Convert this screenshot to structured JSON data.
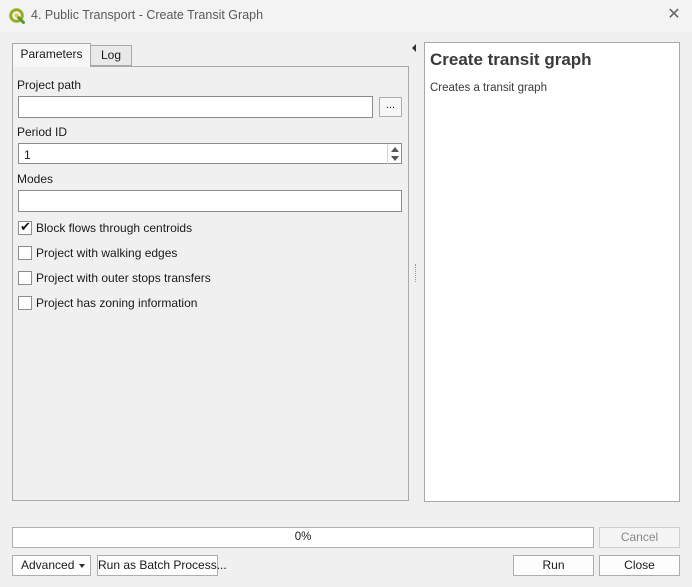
{
  "window": {
    "title": "4. Public Transport - Create Transit Graph",
    "logo_icon": "qgis-logo-icon",
    "close_glyph": "✕"
  },
  "tabs": [
    {
      "label": "Parameters",
      "active": true
    },
    {
      "label": "Log",
      "active": false
    }
  ],
  "form": {
    "project_path": {
      "label": "Project path",
      "value": "",
      "browse_label": "..."
    },
    "period_id": {
      "label": "Period ID",
      "value": "1"
    },
    "modes": {
      "label": "Modes",
      "value": ""
    },
    "checkboxes": [
      {
        "label": "Block flows through centroids",
        "checked": true
      },
      {
        "label": "Project with walking edges",
        "checked": false
      },
      {
        "label": "Project with outer stops transfers",
        "checked": false
      },
      {
        "label": "Project has zoning information",
        "checked": false
      }
    ]
  },
  "help": {
    "title": "Create transit graph",
    "description": "Creates a transit graph"
  },
  "progress": {
    "value": 0,
    "label": "0%"
  },
  "buttons": {
    "cancel": "Cancel",
    "advanced": "Advanced",
    "batch": "Run as Batch Process...",
    "run": "Run",
    "close": "Close"
  },
  "colors": {
    "progress_fill": "#06b025",
    "qgis_green": "#93b023"
  }
}
